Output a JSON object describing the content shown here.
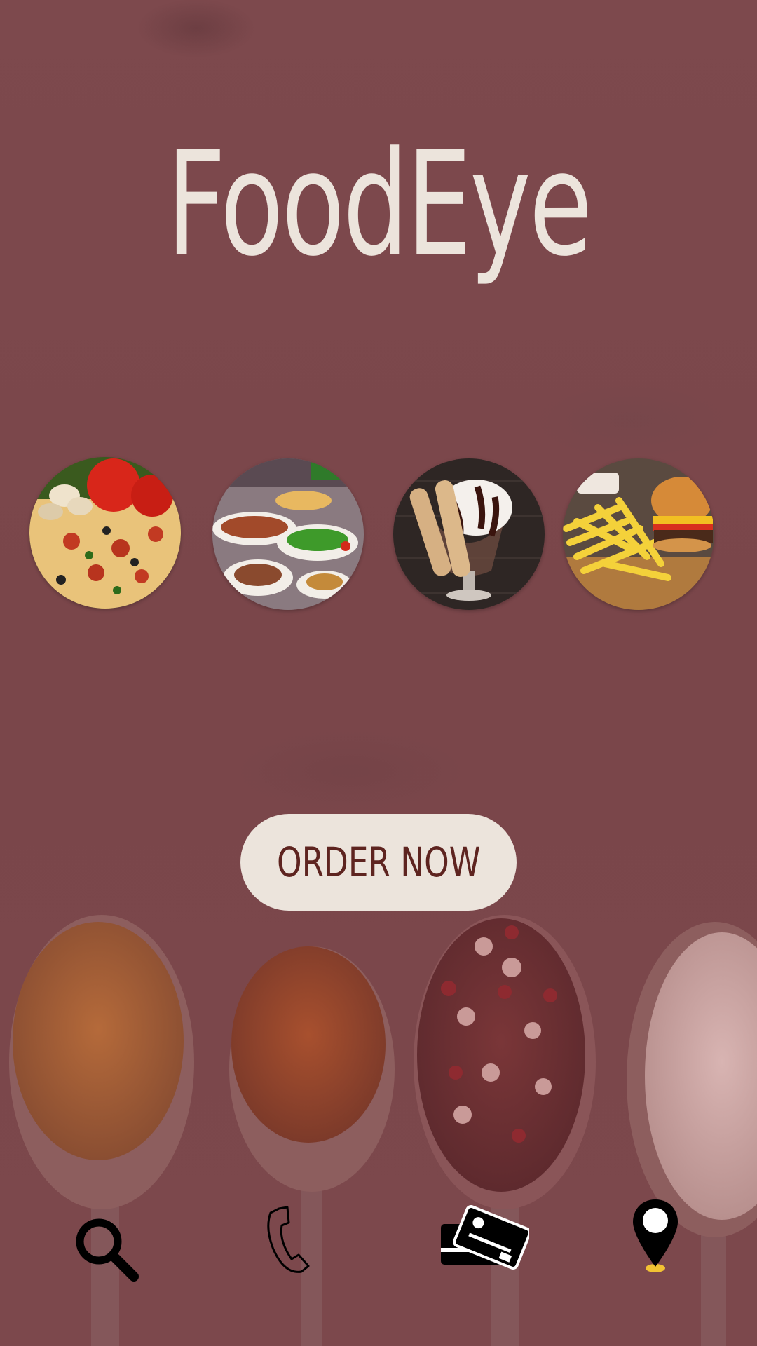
{
  "app": {
    "title": "FoodEye"
  },
  "categories": [
    {
      "name": "pizza"
    },
    {
      "name": "platter"
    },
    {
      "name": "dessert"
    },
    {
      "name": "burger-fries"
    }
  ],
  "cta": {
    "label": "ORDER NOW"
  },
  "nav": [
    {
      "icon": "search-icon"
    },
    {
      "icon": "phone-icon"
    },
    {
      "icon": "credit-card-icon"
    },
    {
      "icon": "location-pin-icon"
    }
  ],
  "colors": {
    "background": "#7a474b",
    "title": "#ece4dc",
    "button_bg": "#ece4dc",
    "button_text": "#5e2420",
    "pin_accent": "#f2c233"
  }
}
